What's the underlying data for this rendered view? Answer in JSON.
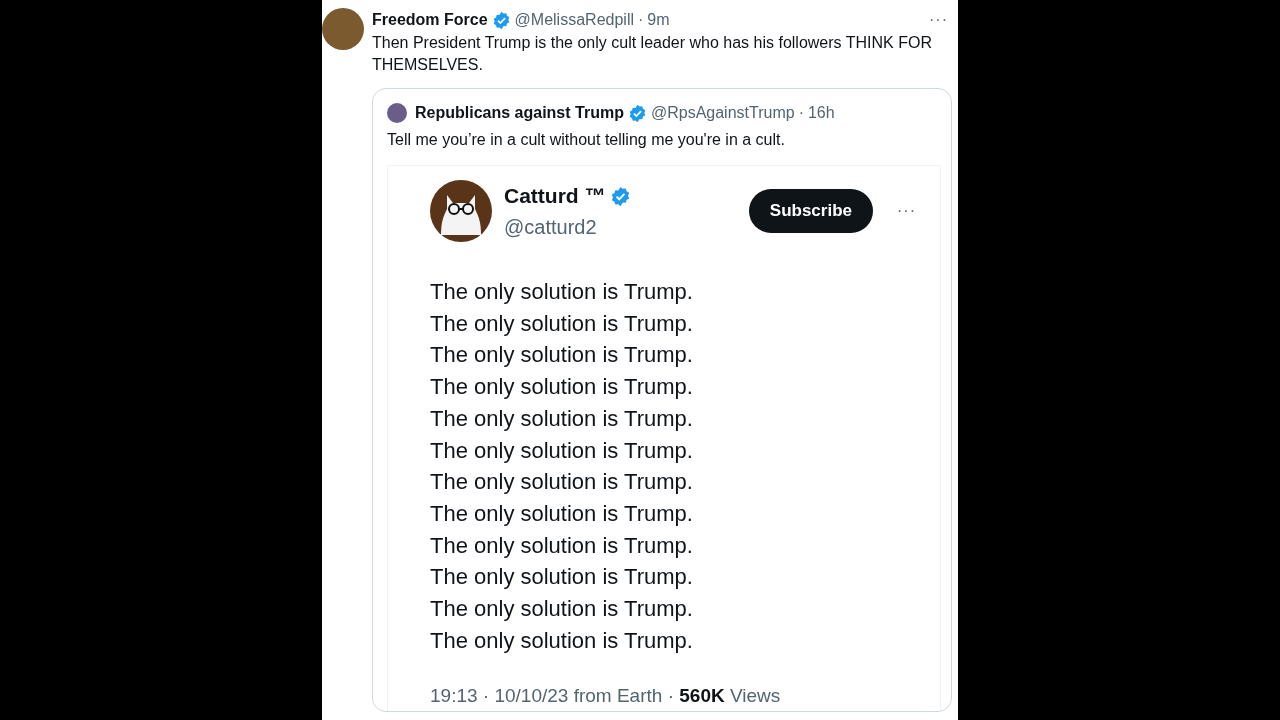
{
  "tweet": {
    "name": "Freedom Force",
    "verified": true,
    "handle": "@MelissaRedpill",
    "separator": "·",
    "time": "9m",
    "more": "···",
    "text": "Then President Trump is the only cult leader who has his followers THINK FOR THEMSELVES.",
    "quote": {
      "name": "Republicans against Trump",
      "verified": true,
      "handle": "@RpsAgainstTrump",
      "separator": "·",
      "time": "16h",
      "text": "Tell me you’re in a cult without telling me you're in a cult.",
      "screenshot": {
        "name": "Catturd ™",
        "verified": true,
        "handle": "@catturd2",
        "button": "Subscribe",
        "more": "···",
        "lines": [
          "The only solution is Trump.",
          "The only solution is Trump.",
          "The only solution is Trump.",
          "The only solution is Trump.",
          "The only solution is Trump.",
          "The only solution is Trump.",
          "The only solution is Trump.",
          "The only solution is Trump.",
          "The only solution is Trump.",
          "The only solution is Trump.",
          "The only solution is Trump.",
          "The only solution is Trump."
        ],
        "footer": "19:13 · 10/10/23 from Earth · **560K** Views"
      }
    }
  }
}
